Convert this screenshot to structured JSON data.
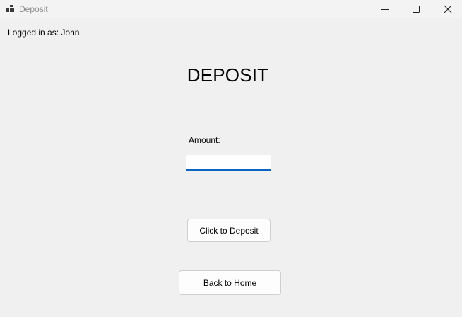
{
  "window": {
    "title": "Deposit",
    "icon": "app-window-icon",
    "controls": [
      "minimize-icon",
      "maximize-icon",
      "close-icon"
    ]
  },
  "session": {
    "logged_in_text": "Logged in as: John"
  },
  "main": {
    "title": "DEPOSIT",
    "amount_label": "Amount:",
    "amount_value": "",
    "deposit_button": "Click to Deposit",
    "home_button": "Back to Home"
  },
  "colors": {
    "background": "#f0f0f0",
    "input_focus_underline": "#0a66c2"
  }
}
